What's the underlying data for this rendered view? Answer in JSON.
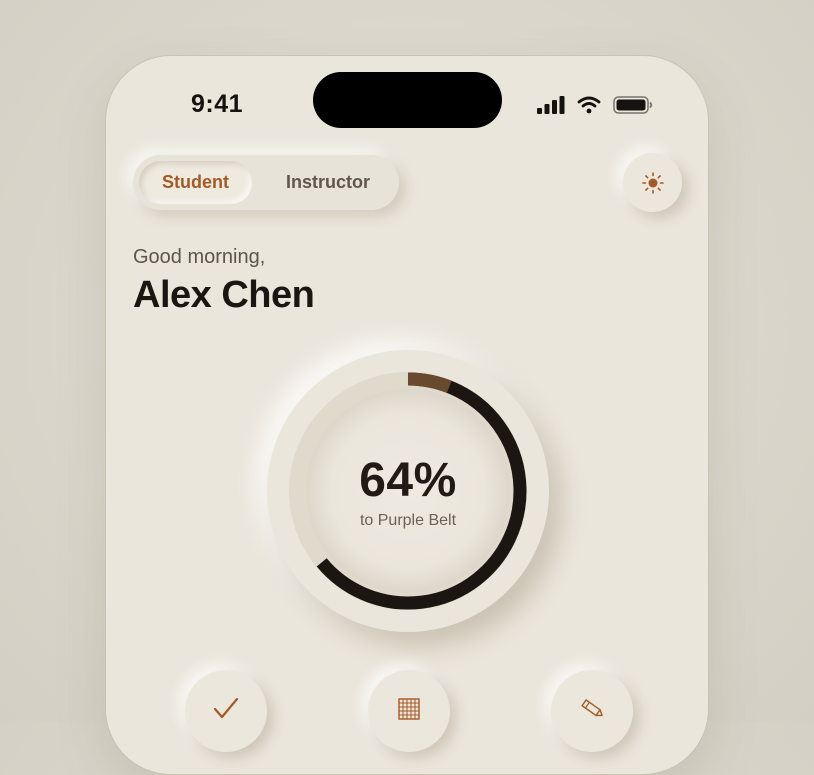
{
  "status_bar": {
    "time": "9:41",
    "icons": [
      "cellular-signal-icon",
      "wifi-icon",
      "battery-icon"
    ]
  },
  "mode_toggle": {
    "options": [
      "Student",
      "Instructor"
    ],
    "selected": "Student"
  },
  "theme_toggle": {
    "icon": "sun-icon"
  },
  "greeting": {
    "salutation": "Good morning,",
    "name": "Alex Chen"
  },
  "progress": {
    "percent_label": "64%",
    "value": 0.64,
    "goal": "to Purple Belt"
  },
  "quick_actions": [
    {
      "icon": "checkmark-icon"
    },
    {
      "icon": "calendar-grid-icon"
    },
    {
      "icon": "pencil-icon"
    }
  ],
  "colors": {
    "background": "#ebe6dc",
    "accent": "#a35a25",
    "text_primary": "#1c1612",
    "ring_fill": "#1c1612"
  }
}
